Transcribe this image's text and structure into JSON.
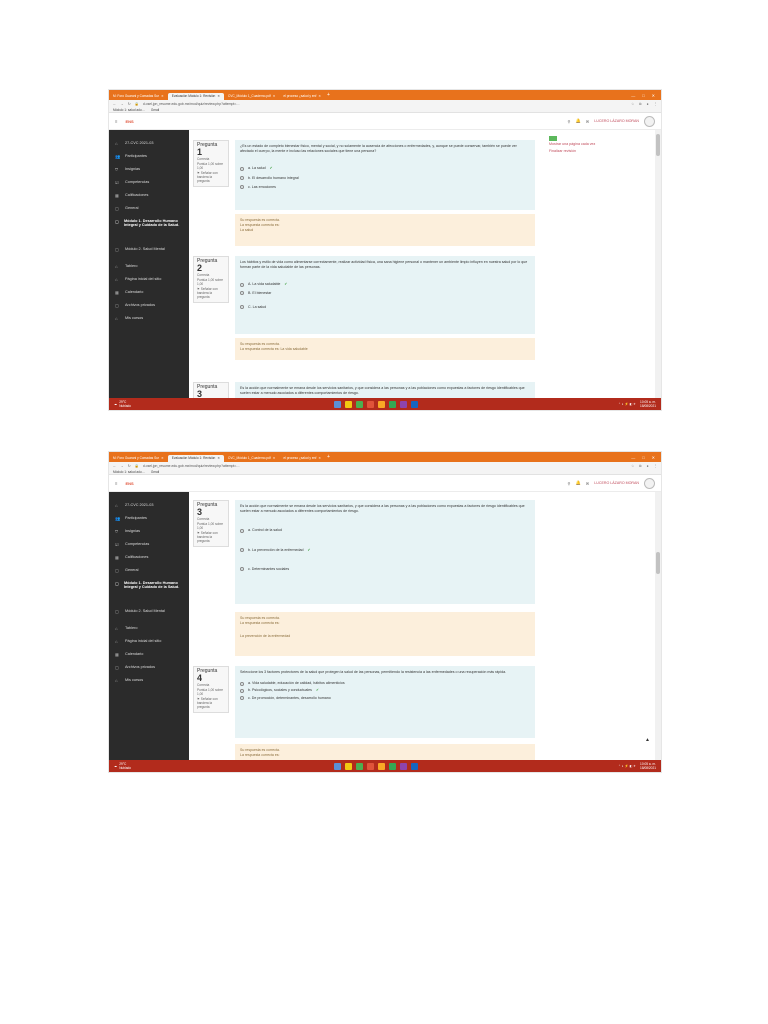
{
  "browser": {
    "tabs": [
      "M: Foro Guarani y Comadas Sur",
      "Evaluación Módulo 1: Revisión",
      "CVC_Módulo 1_Cuaderno.pdf",
      "el proceso ¿salud y enf"
    ],
    "url": "d.osel.jpn_resume.edu.gob.mx/mod/quiz/review.php?attempt=…",
    "bookmarks": [
      "Módulo 1: salud adu…",
      "Gmail"
    ],
    "window_controls": [
      "—",
      "□",
      "✕"
    ]
  },
  "moodle": {
    "logo": "ENS",
    "user_name": "LUCERO LÁZARO MORAN"
  },
  "sidebar": {
    "items": [
      {
        "icon": "⌂",
        "label": "27-CVC 2021-03"
      },
      {
        "icon": "👥",
        "label": "Participantes"
      },
      {
        "icon": "⛉",
        "label": "Insignias"
      },
      {
        "icon": "☑",
        "label": "Competencias"
      },
      {
        "icon": "▦",
        "label": "Calificaciones"
      },
      {
        "icon": "▢",
        "label": "General"
      },
      {
        "icon": "▢",
        "label": "Módulo 1. Desarrollo Humano Integral y Cuidado de la Salud."
      },
      {
        "icon": "▢",
        "label": "Módulo 2. Salud Mental"
      },
      {
        "icon": "⌂",
        "label": "Tablero"
      },
      {
        "icon": "⌂",
        "label": "Página inicial del sitio"
      },
      {
        "icon": "▦",
        "label": "Calendario"
      },
      {
        "icon": "▢",
        "label": "Archivos privados"
      },
      {
        "icon": "⌂",
        "label": "Mis cursos"
      }
    ]
  },
  "navpanel": {
    "link1": "Mostrar una página cada vez",
    "link2": "Finalizar revisión"
  },
  "labels": {
    "pregunta": "Pregunta",
    "correcta": "Correcta",
    "puntua": "Puntúa 1,00 sobre 1,00",
    "senalar": "Señalar con bandera la pregunta"
  },
  "shot1": {
    "q1": {
      "num": "1",
      "text": "¿Es un estado de completo bienestar físico, mental y social, y no solamente la ausencia de afecciones o enfermedades, y, aunque se puede conservar, también se puede ver afectado el cuerpo, la mente e incluso las relaciones sociales que tiene una persona?",
      "options": [
        "a.  La salud",
        "b.  El desarrollo humano integral",
        "c.  Las emociones"
      ],
      "correct_index": 0,
      "feedback": [
        "Su respuesta es correcta.",
        "La respuesta correcta es:",
        "La salud"
      ]
    },
    "q2": {
      "num": "2",
      "text": "Los hábitos y estilo de vida como alimentarse correctamente, realizar actividad física, una sana higiene personal o mantener un ambiente limpio influyen en nuestra salud por lo que forman parte de la vida saludable de las personas.",
      "options": [
        "A.  La vida saludable",
        "B.  El bienestar",
        "C.  La salud"
      ],
      "correct_index": 0,
      "feedback": [
        "Su respuesta es correcta.",
        "La respuesta correcta es: La vida saludable"
      ]
    },
    "q3": {
      "num": "3",
      "text": "Es la acción que normalmente se emana desde los servicios sanitarios, y que considera a las personas y a las poblaciones como expuestas a factores de riesgo identificables que suelen estar a menudo asociados a diferentes comportamientos de riesgo."
    }
  },
  "shot2": {
    "q3": {
      "num": "3",
      "text": "Es la acción que normalmente se emana desde los servicios sanitarios, y que considera a las personas y a las poblaciones como expuestas a factores de riesgo identificables que suelen estar a menudo asociados a diferentes comportamientos de riesgo.",
      "options": [
        "a.  Control de la salud",
        "b.  La prevención de la enfermedad",
        "c.  Determinantes sociales"
      ],
      "correct_index": 1,
      "feedback": [
        "Su respuesta es correcta.",
        "La respuesta correcta es:",
        "La prevención de la enfermedad"
      ]
    },
    "q4": {
      "num": "4",
      "text": "Seleccione los 3 factores protectores de la salud que protegen la salud de las personas, permitiendo la resistencia a las enfermedades o una recuperación más rápida.",
      "options": [
        "a.  Vida saludable, educación de calidad, hábitos alimenticios",
        "b.  Psicológicos, sociales y conductuales",
        "c.  De promoción, determinantes, desarrollo humano"
      ],
      "correct_index": 1,
      "feedback": [
        "Su respuesta es correcta.",
        "La respuesta correcta es:"
      ]
    }
  },
  "taskbar": {
    "weather_temp": "29°C",
    "weather_text": "Nublado",
    "time": "10:05 a. m.",
    "date": "18/08/2021"
  },
  "icons": [
    "menu-icon",
    "bell-icon",
    "chat-icon",
    "lock-icon",
    "star-icon",
    "back-icon",
    "forward-icon",
    "reload-icon",
    "check-icon",
    "arrow-up-icon"
  ],
  "colors": {
    "tabbar": "#e8721c",
    "sidebar": "#2b2b2b",
    "question_bg": "#e7f3f5",
    "feedback_bg": "#fcefdc",
    "taskbar": "#b22b1c",
    "link": "#c04a5a"
  }
}
